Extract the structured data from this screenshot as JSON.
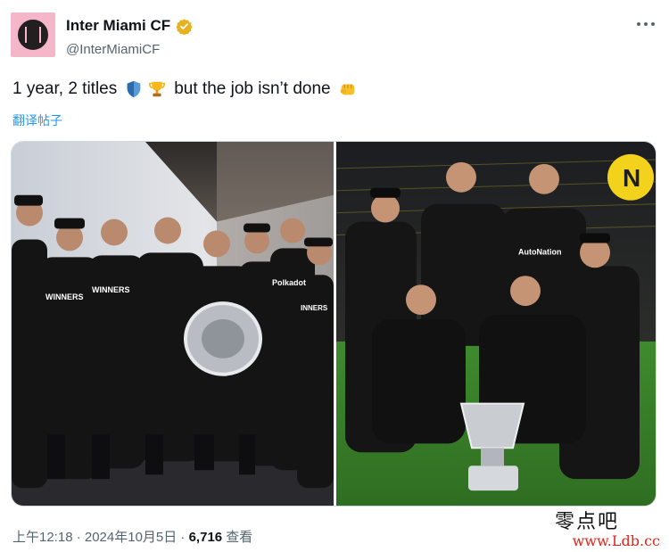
{
  "author": {
    "display_name": "Inter Miami CF",
    "handle": "@InterMiamiCF",
    "verified": true,
    "avatar_icon": "inter-miami-crest-icon",
    "brand_pink": "#f4b6c9"
  },
  "tweet": {
    "text_part1": "1 year, 2 titles",
    "emoji_1": "shield-icon",
    "emoji_2": "trophy-icon",
    "text_part2": "but the job isn’t done",
    "emoji_3": "fist-icon",
    "translate_label": "翻译帖子"
  },
  "media": {
    "left_photo": {
      "shirt_text_1": "WINNERS",
      "shirt_text_2": "WINNERS",
      "shirt_text_3": "Polkadot",
      "shirt_text_4": "INNERS"
    },
    "right_photo": {
      "stadium_sign": "N",
      "shirt_sponsor": "AutoNation"
    }
  },
  "meta": {
    "timestamp": "上午12:18 · 2024年10月5日 · ",
    "views_count": "6,716",
    "views_label": " 查看"
  },
  "watermark": {
    "chinese": "零点吧",
    "url": "www.Ldb.cc"
  }
}
